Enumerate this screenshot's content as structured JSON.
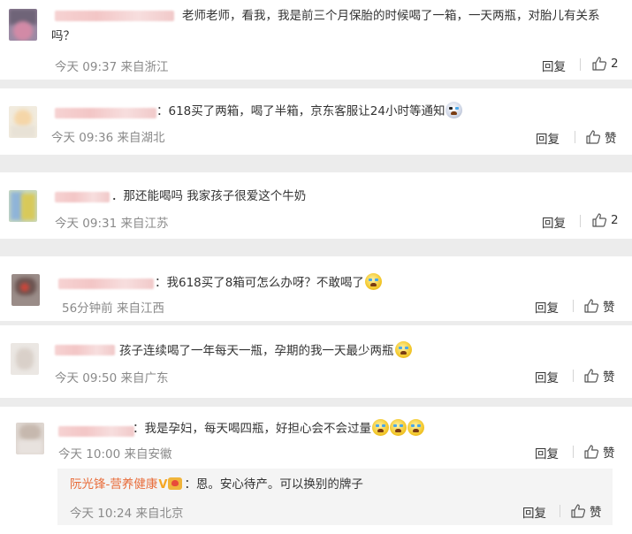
{
  "comments": [
    {
      "text": "老师老师，看我，我是前三个月保胎的时候喝了一箱，一天两瓶，对胎儿有关系吗？",
      "meta": "今天 09:37 来自浙江",
      "reply_label": "回复",
      "like_label": "2"
    },
    {
      "text": "：618买了两箱，喝了半箱，京东客服让24小时等通知",
      "emoji": "scared-face",
      "meta": "今天 09:36 来自湖北",
      "reply_label": "回复",
      "like_label": "赞"
    },
    {
      "text": "．那还能喝吗 我家孩子很爱这个牛奶",
      "meta": "今天 09:31 来自江苏",
      "reply_label": "回复",
      "like_label": "2"
    },
    {
      "text": "：我618买了8箱可怎么办呀？不敢喝了",
      "emoji": "crying-face",
      "meta": "56分钟前 来自江西",
      "reply_label": "回复",
      "like_label": "赞"
    },
    {
      "text": "孩子连续喝了一年每天一瓶，孕期的我一天最少两瓶",
      "emoji": "crying-face",
      "meta": "今天 09:50 来自广东",
      "reply_label": "回复",
      "like_label": "赞"
    },
    {
      "text": "：我是孕妇，每天喝四瓶，好担心会不会过量",
      "emoji_count": 3,
      "emoji": "crying-face",
      "meta": "今天 10:00 来自安徽",
      "reply_label": "回复",
      "like_label": "赞"
    }
  ],
  "sub_reply": {
    "username": "阮光锋-营养健康",
    "badge_v": "V",
    "text": "：恩。安心待产。可以换别的牌子",
    "meta": "今天 10:24 来自北京",
    "reply_label": "回复",
    "like_label": "赞"
  },
  "colors": {
    "background": "#ececec",
    "card": "#ffffff",
    "text": "#333333",
    "meta": "#8a8a8a",
    "username": "#e86c3a",
    "badge": "#f5a623"
  }
}
